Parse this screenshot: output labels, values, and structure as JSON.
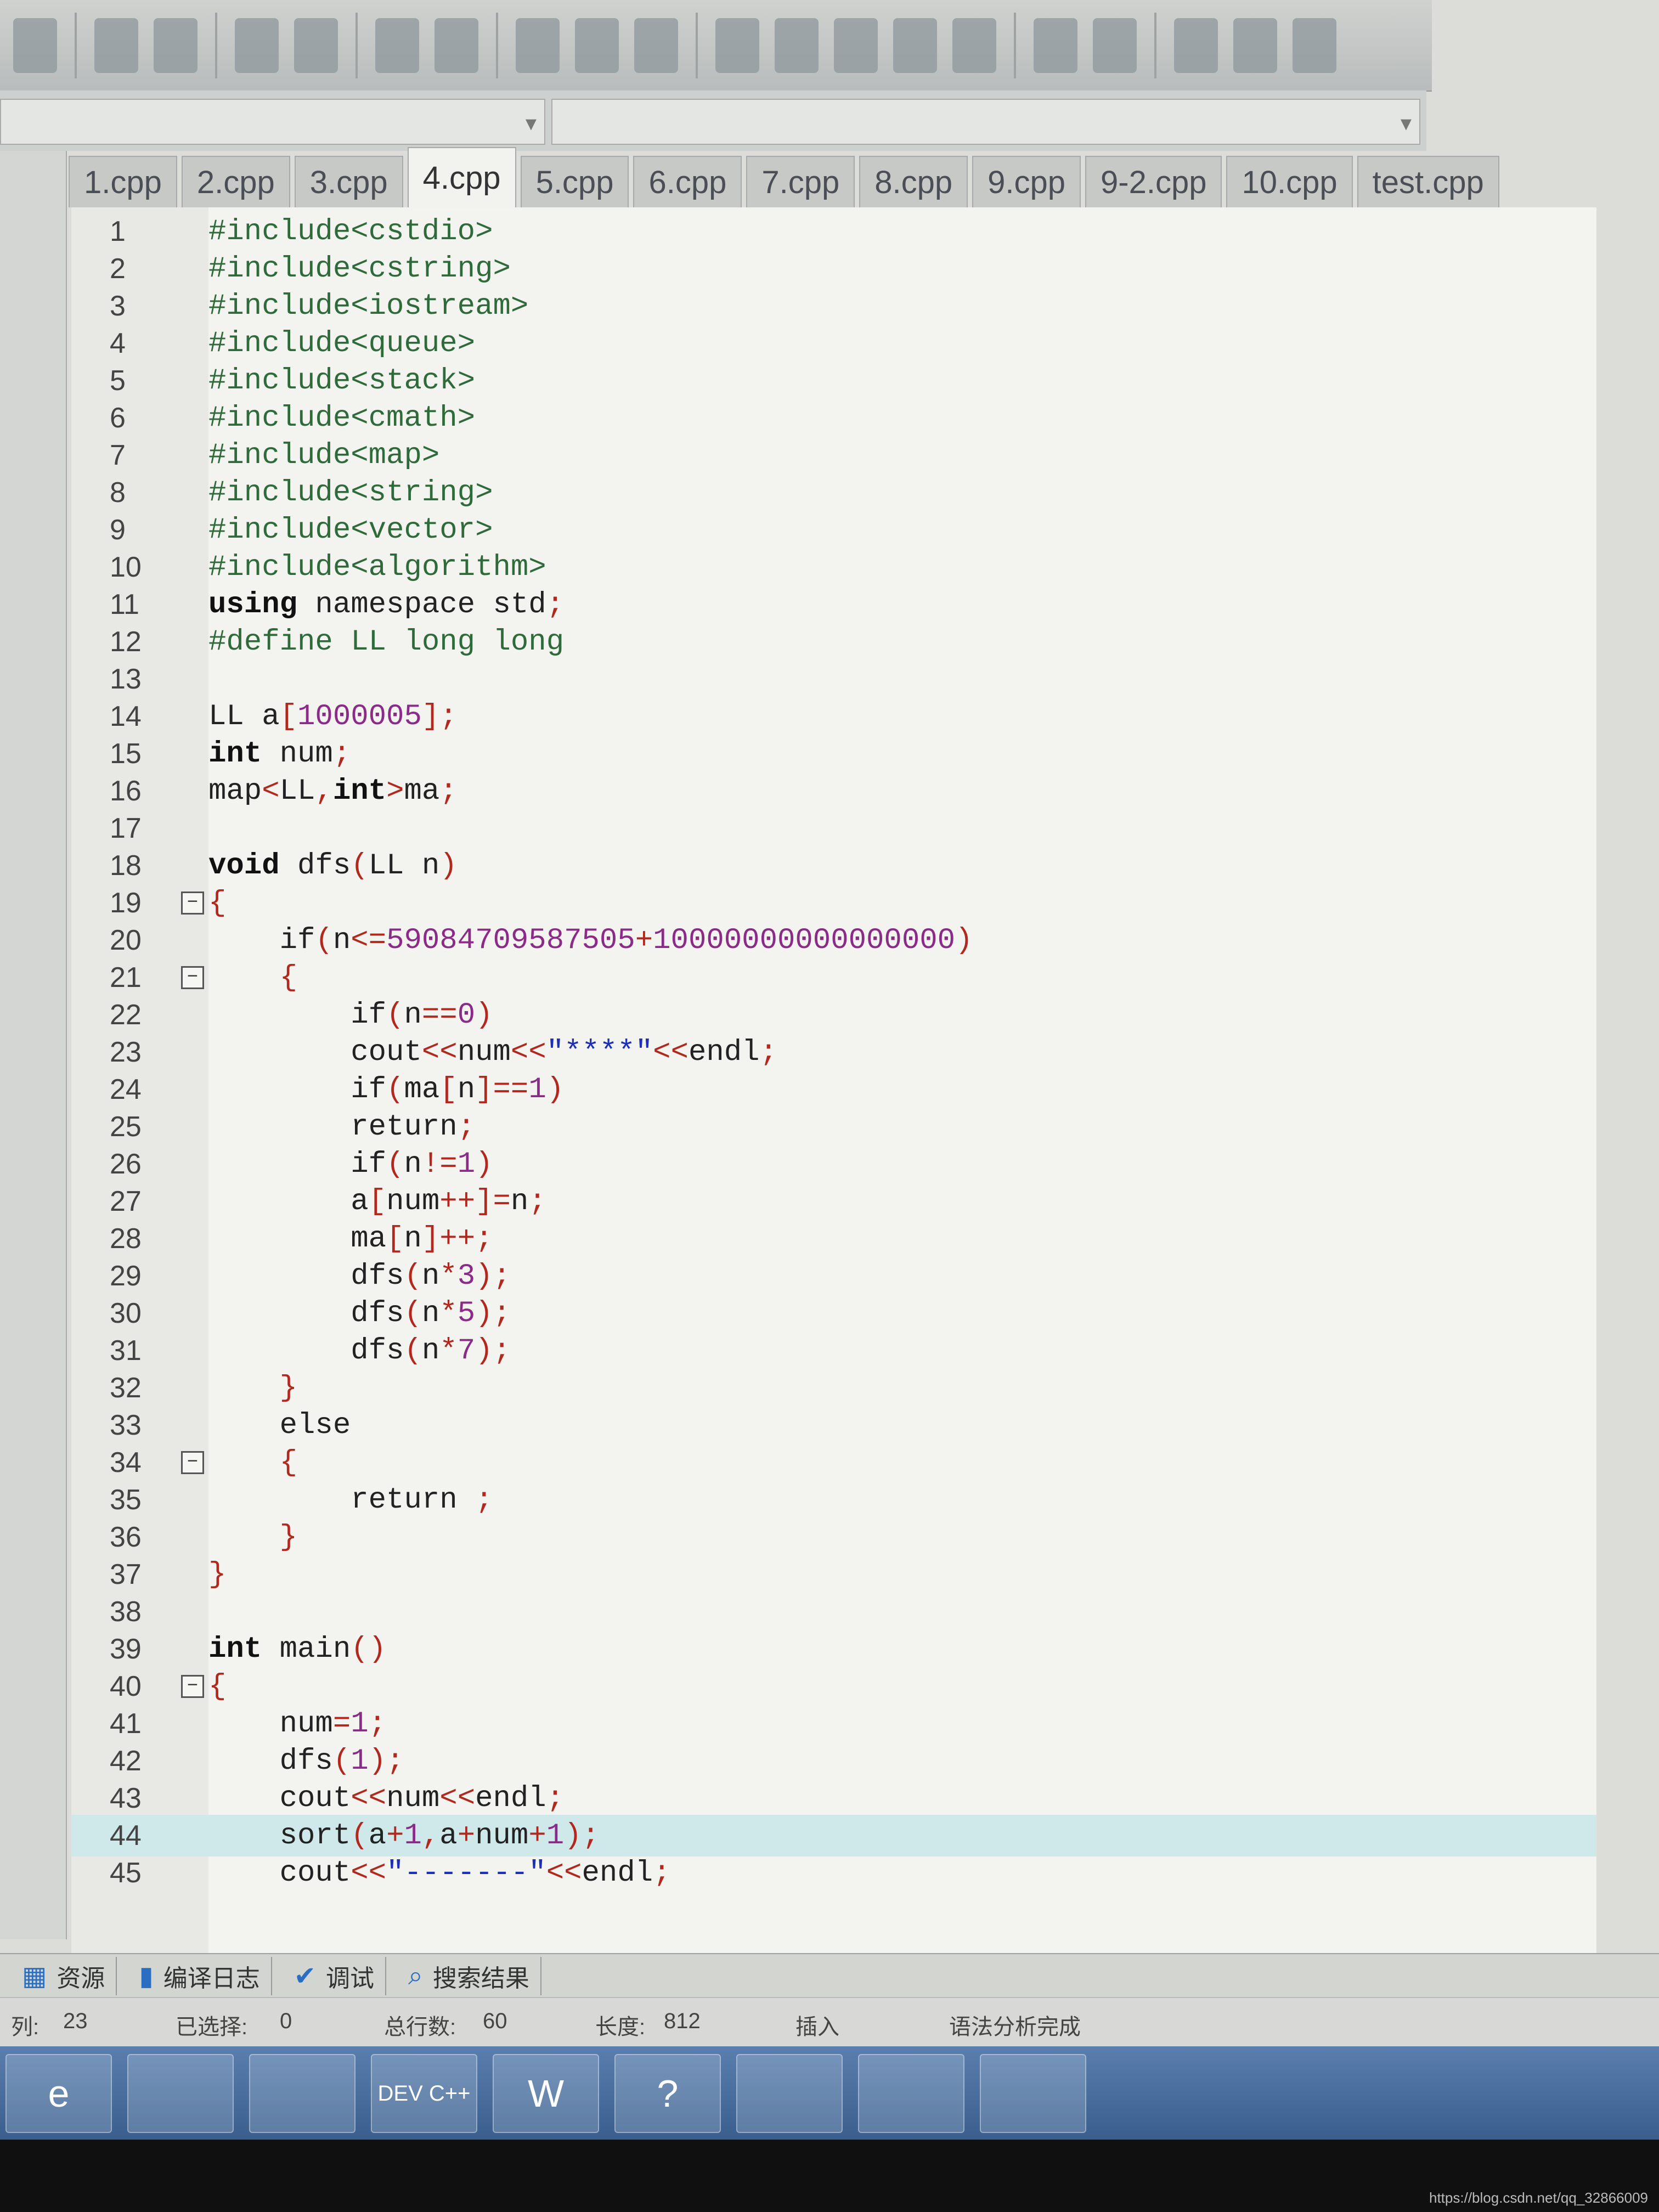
{
  "tabs": [
    "1.cpp",
    "2.cpp",
    "3.cpp",
    "4.cpp",
    "5.cpp",
    "6.cpp",
    "7.cpp",
    "8.cpp",
    "9.cpp",
    "9-2.cpp",
    "10.cpp",
    "test.cpp"
  ],
  "active_tab": "4.cpp",
  "code_lines": [
    {
      "n": "1",
      "t": "#include<cstdio>"
    },
    {
      "n": "2",
      "t": "#include<cstring>"
    },
    {
      "n": "3",
      "t": "#include<iostream>"
    },
    {
      "n": "4",
      "t": "#include<queue>"
    },
    {
      "n": "5",
      "t": "#include<stack>"
    },
    {
      "n": "6",
      "t": "#include<cmath>"
    },
    {
      "n": "7",
      "t": "#include<map>"
    },
    {
      "n": "8",
      "t": "#include<string>"
    },
    {
      "n": "9",
      "t": "#include<vector>"
    },
    {
      "n": "10",
      "t": "#include<algorithm>"
    },
    {
      "n": "11",
      "t": "using namespace std;"
    },
    {
      "n": "12",
      "t": "#define LL long long"
    },
    {
      "n": "13",
      "t": ""
    },
    {
      "n": "14",
      "t": "LL a[1000005];"
    },
    {
      "n": "15",
      "t": "int num;"
    },
    {
      "n": "16",
      "t": "map<LL,int>ma;"
    },
    {
      "n": "17",
      "t": ""
    },
    {
      "n": "18",
      "t": "void dfs(LL n)"
    },
    {
      "n": "19",
      "t": "{"
    },
    {
      "n": "20",
      "t": "    if(n<=59084709587505+10000000000000000)"
    },
    {
      "n": "21",
      "t": "    {"
    },
    {
      "n": "22",
      "t": "        if(n==0)"
    },
    {
      "n": "23",
      "t": "        cout<<num<<\"****\"<<endl;"
    },
    {
      "n": "24",
      "t": "        if(ma[n]==1)"
    },
    {
      "n": "25",
      "t": "        return;"
    },
    {
      "n": "26",
      "t": "        if(n!=1)"
    },
    {
      "n": "27",
      "t": "        a[num++]=n;"
    },
    {
      "n": "28",
      "t": "        ma[n]++;"
    },
    {
      "n": "29",
      "t": "        dfs(n*3);"
    },
    {
      "n": "30",
      "t": "        dfs(n*5);"
    },
    {
      "n": "31",
      "t": "        dfs(n*7);"
    },
    {
      "n": "32",
      "t": "    }"
    },
    {
      "n": "33",
      "t": "    else"
    },
    {
      "n": "34",
      "t": "    {"
    },
    {
      "n": "35",
      "t": "        return ;"
    },
    {
      "n": "36",
      "t": "    }"
    },
    {
      "n": "37",
      "t": "}"
    },
    {
      "n": "38",
      "t": ""
    },
    {
      "n": "39",
      "t": "int main()"
    },
    {
      "n": "40",
      "t": "{"
    },
    {
      "n": "41",
      "t": "    num=1;"
    },
    {
      "n": "42",
      "t": "    dfs(1);"
    },
    {
      "n": "43",
      "t": "    cout<<num<<endl;"
    },
    {
      "n": "44",
      "t": "    sort(a+1,a+num+1);"
    },
    {
      "n": "45",
      "t": "    cout<<\"-------\"<<endl;"
    }
  ],
  "fold_lines": [
    "19",
    "21",
    "34",
    "40"
  ],
  "highlight_line": "44",
  "bottom_tabs": [
    {
      "icon": "resources-icon",
      "label": "资源"
    },
    {
      "icon": "chart-icon",
      "label": "编译日志"
    },
    {
      "icon": "check-icon",
      "label": "调试"
    },
    {
      "icon": "search-icon",
      "label": "搜索结果"
    }
  ],
  "status": {
    "col_label": "列:",
    "col_value": "23",
    "selected_label": "已选择:",
    "selected_value": "0",
    "lines_label": "总行数:",
    "lines_value": "60",
    "length_label": "长度:",
    "length_value": "812",
    "mode": "插入",
    "message": "语法分析完成"
  },
  "taskbar": [
    {
      "icon": "ie-icon",
      "label": "e"
    },
    {
      "icon": "folder-icon",
      "label": ""
    },
    {
      "icon": "chrome-icon",
      "label": ""
    },
    {
      "icon": "devcpp-icon",
      "label": "DEV C++"
    },
    {
      "icon": "word-icon",
      "label": "W"
    },
    {
      "icon": "help-icon",
      "label": "?"
    },
    {
      "icon": "window-icon",
      "label": ""
    },
    {
      "icon": "book-icon",
      "label": ""
    },
    {
      "icon": "screen-icon",
      "label": ""
    }
  ],
  "watermark": "https://blog.csdn.net/qq_32866009"
}
